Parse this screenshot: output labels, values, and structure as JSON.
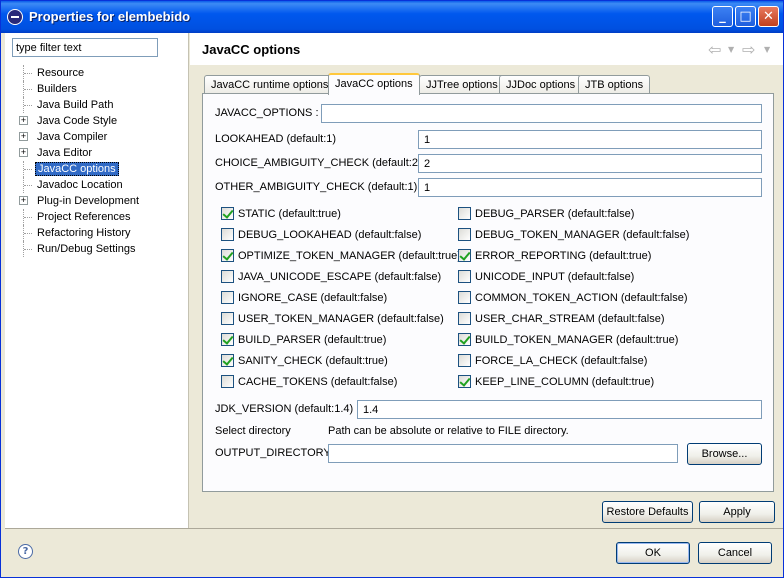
{
  "window": {
    "title": "Properties for elembebido"
  },
  "filter": {
    "placeholder": "type filter text"
  },
  "tree": [
    {
      "label": "Resource",
      "expandable": false,
      "selected": false
    },
    {
      "label": "Builders",
      "expandable": false,
      "selected": false
    },
    {
      "label": "Java Build Path",
      "expandable": false,
      "selected": false
    },
    {
      "label": "Java Code Style",
      "expandable": true,
      "selected": false
    },
    {
      "label": "Java Compiler",
      "expandable": true,
      "selected": false
    },
    {
      "label": "Java Editor",
      "expandable": true,
      "selected": false
    },
    {
      "label": "JavaCC options",
      "expandable": false,
      "selected": true
    },
    {
      "label": "Javadoc Location",
      "expandable": false,
      "selected": false
    },
    {
      "label": "Plug-in Development",
      "expandable": true,
      "selected": false
    },
    {
      "label": "Project References",
      "expandable": false,
      "selected": false
    },
    {
      "label": "Refactoring History",
      "expandable": false,
      "selected": false
    },
    {
      "label": "Run/Debug Settings",
      "expandable": false,
      "selected": false
    }
  ],
  "page": {
    "title": "JavaCC options"
  },
  "tabs": [
    {
      "label": "JavaCC runtime options",
      "active": false
    },
    {
      "label": "JavaCC options",
      "active": true
    },
    {
      "label": "JJTree options",
      "active": false
    },
    {
      "label": "JJDoc options",
      "active": false
    },
    {
      "label": "JTB options",
      "active": false
    }
  ],
  "fields": {
    "javacc_options": {
      "label": "JAVACC_OPTIONS :",
      "value": ""
    },
    "lookahead": {
      "label": "LOOKAHEAD (default:1)",
      "value": "1"
    },
    "choice_ambiguity": {
      "label": "CHOICE_AMBIGUITY_CHECK (default:2)",
      "value": "2"
    },
    "other_ambiguity": {
      "label": "OTHER_AMBIGUITY_CHECK (default:1)",
      "value": "1"
    }
  },
  "checkboxes_left": [
    {
      "label": "STATIC (default:true)",
      "checked": true
    },
    {
      "label": "DEBUG_LOOKAHEAD (default:false)",
      "checked": false
    },
    {
      "label": "OPTIMIZE_TOKEN_MANAGER (default:true)",
      "checked": true
    },
    {
      "label": "JAVA_UNICODE_ESCAPE (default:false)",
      "checked": false
    },
    {
      "label": "IGNORE_CASE (default:false)",
      "checked": false
    },
    {
      "label": "USER_TOKEN_MANAGER (default:false)",
      "checked": false
    },
    {
      "label": "BUILD_PARSER (default:true)",
      "checked": true
    },
    {
      "label": "SANITY_CHECK (default:true)",
      "checked": true
    },
    {
      "label": "CACHE_TOKENS (default:false)",
      "checked": false
    }
  ],
  "checkboxes_right": [
    {
      "label": "DEBUG_PARSER (default:false)",
      "checked": false
    },
    {
      "label": "DEBUG_TOKEN_MANAGER (default:false)",
      "checked": false
    },
    {
      "label": "ERROR_REPORTING (default:true)",
      "checked": true
    },
    {
      "label": "UNICODE_INPUT (default:false)",
      "checked": false
    },
    {
      "label": "COMMON_TOKEN_ACTION (default:false)",
      "checked": false
    },
    {
      "label": "USER_CHAR_STREAM (default:false)",
      "checked": false
    },
    {
      "label": "BUILD_TOKEN_MANAGER (default:true)",
      "checked": true
    },
    {
      "label": "FORCE_LA_CHECK (default:false)",
      "checked": false
    },
    {
      "label": "KEEP_LINE_COLUMN (default:true)",
      "checked": true
    }
  ],
  "jdk": {
    "label": "JDK_VERSION (default:1.4)",
    "value": "1.4"
  },
  "directory": {
    "select_label": "Select directory",
    "hint": "Path can be absolute or relative to FILE directory.",
    "output_label": "OUTPUT_DIRECTORY",
    "output_value": "",
    "browse_label": "Browse..."
  },
  "buttons": {
    "restore_defaults": "Restore Defaults",
    "apply": "Apply",
    "ok": "OK",
    "cancel": "Cancel"
  },
  "icons": {
    "help": "help-icon",
    "back": "back-arrow-icon",
    "forward": "forward-arrow-icon"
  },
  "colors": {
    "titlebar": "#0058ee",
    "selection": "#316ac5",
    "tab_highlight": "#ffc83c",
    "check": "#21a121"
  }
}
